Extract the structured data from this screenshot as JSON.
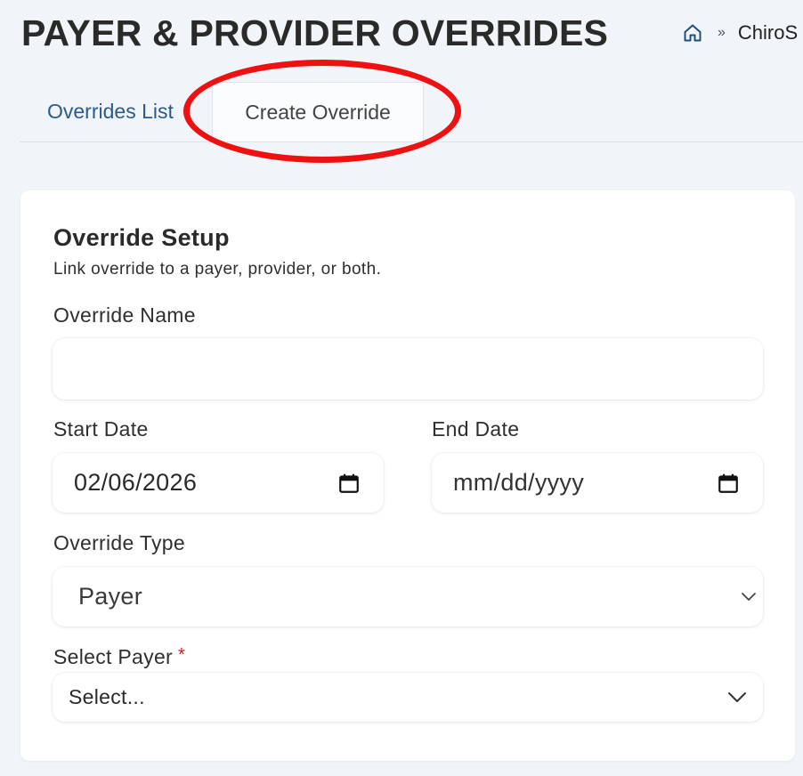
{
  "header": {
    "title": "PAYER & PROVIDER OVERRIDES",
    "breadcrumb": {
      "home_icon": "home-icon",
      "separator": "»",
      "current": "ChiroS"
    }
  },
  "tabs": [
    {
      "label": "Overrides List",
      "active": false
    },
    {
      "label": "Create Override",
      "active": true,
      "annotation": "red-circle-highlight"
    }
  ],
  "form": {
    "section_title": "Override Setup",
    "section_subtitle": "Link override to a payer, provider, or both.",
    "override_name": {
      "label": "Override Name",
      "value": "",
      "placeholder": ""
    },
    "start_date": {
      "label": "Start Date",
      "value": "02/06/2026",
      "icon": "calendar-icon"
    },
    "end_date": {
      "label": "End Date",
      "value": "mm/dd/yyyy",
      "icon": "calendar-icon"
    },
    "override_type": {
      "label": "Override Type",
      "selected": "Payer",
      "icon": "chevron-down-icon"
    },
    "select_payer": {
      "label": "Select Payer",
      "required_mark": "*",
      "selected": "Select...",
      "icon": "chevron-down-icon"
    }
  },
  "colors": {
    "page_background": "#f1f4f8",
    "card_background": "#ffffff",
    "tab_link": "#2a5c8a",
    "highlight_ring": "#ee1111",
    "required": "#d01b1b"
  }
}
